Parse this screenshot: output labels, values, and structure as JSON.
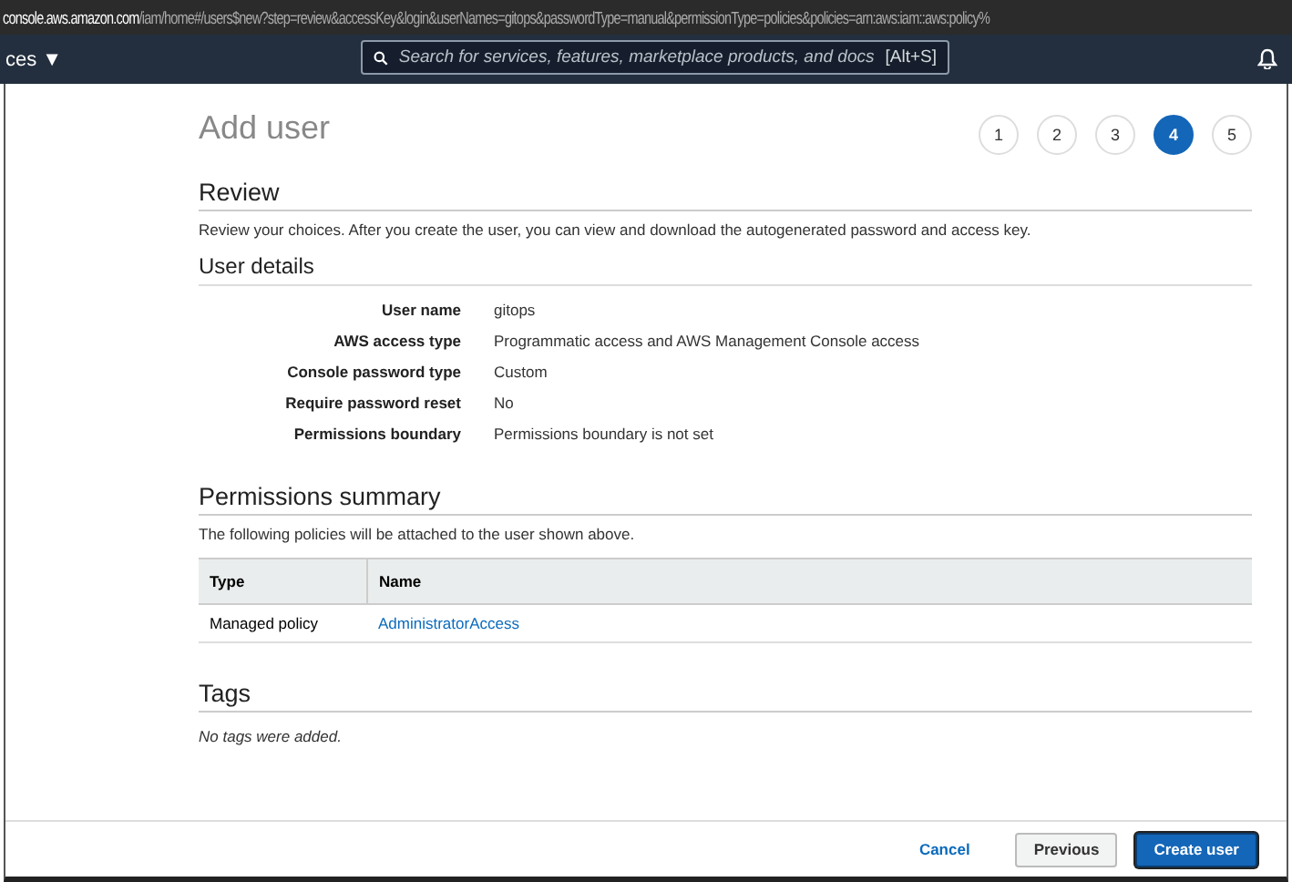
{
  "browser": {
    "host": "console.aws.amazon.com",
    "path": "/iam/home#/users$new?step=review&accessKey&login&userNames=gitops&passwordType=manual&permissionType=policies&policies=arn:aws:iam::aws:policy%"
  },
  "navbar": {
    "services_label": "ces ▼",
    "search": {
      "placeholder": "Search for services, features, marketplace products, and docs",
      "shortcut": "[Alt+S]"
    }
  },
  "title": "Add user",
  "steps": [
    {
      "label": "1",
      "selected": false
    },
    {
      "label": "2",
      "selected": false
    },
    {
      "label": "3",
      "selected": false
    },
    {
      "label": "4",
      "selected": true
    },
    {
      "label": "5",
      "selected": false
    }
  ],
  "review": {
    "heading": "Review",
    "description": "Review your choices. After you create the user, you can view and download the autogenerated password and access key."
  },
  "user_details": {
    "heading": "User details",
    "rows": [
      {
        "label": "User name",
        "value": "gitops"
      },
      {
        "label": "AWS access type",
        "value": "Programmatic access and AWS Management Console access"
      },
      {
        "label": "Console password type",
        "value": "Custom"
      },
      {
        "label": "Require password reset",
        "value": "No"
      },
      {
        "label": "Permissions boundary",
        "value": "Permissions boundary is not set"
      }
    ]
  },
  "permissions": {
    "heading": "Permissions summary",
    "description": "The following policies will be attached to the user shown above.",
    "table": {
      "columns": [
        "Type",
        "Name"
      ],
      "rows": [
        [
          "Managed policy",
          "AdministratorAccess"
        ]
      ]
    }
  },
  "tags": {
    "heading": "Tags",
    "empty_text": "No tags were added."
  },
  "footer": {
    "buttons": [
      {
        "label": "Cancel",
        "kind": "link"
      },
      {
        "label": "Previous",
        "kind": "secondary"
      },
      {
        "label": "Create user",
        "kind": "primary"
      }
    ]
  }
}
